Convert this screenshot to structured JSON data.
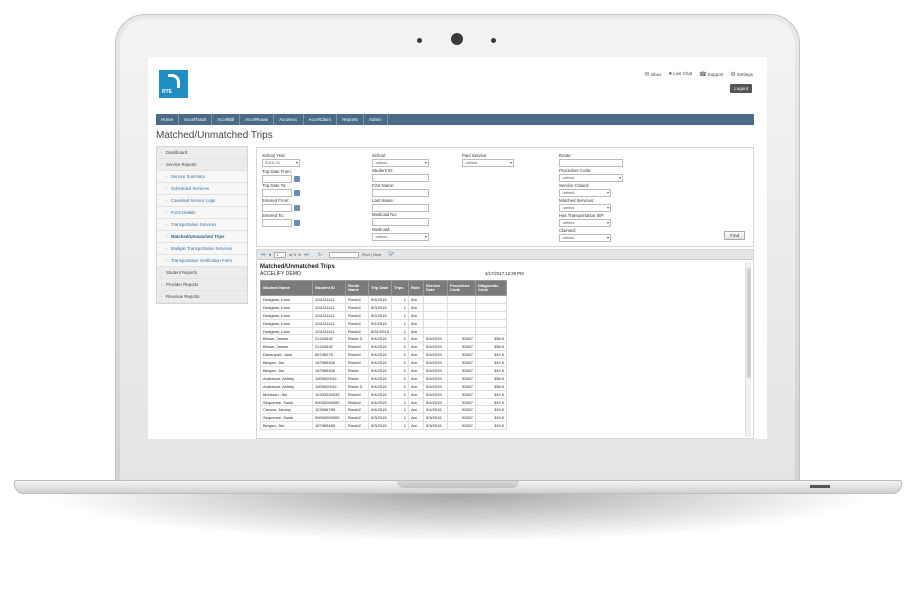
{
  "app": {
    "logo_text": "RTE",
    "topnav": [
      {
        "icon": "mail-icon",
        "glyph": "✉",
        "label": "Inbox"
      },
      {
        "icon": "chat-icon",
        "glyph": "●",
        "label": "Live Chat"
      },
      {
        "icon": "support-icon",
        "glyph": "☎",
        "label": "Support"
      },
      {
        "icon": "gear-icon",
        "glyph": "⚙",
        "label": "Settings"
      }
    ],
    "logout_label": "Logout"
  },
  "menu": [
    "Home",
    "AccelTrack",
    "AccelBill",
    "AccelRoute",
    "AccelAcc",
    "AccelClaim",
    "Reports",
    "Admin"
  ],
  "page_title": "Matched/Unmatched Trips",
  "sidebar": [
    {
      "label": "Dashboard",
      "kind": "hdr"
    },
    {
      "label": "Service Reports",
      "kind": "hdr"
    },
    {
      "label": "Service Summary",
      "kind": "sub"
    },
    {
      "label": "Scheduled Services",
      "kind": "sub"
    },
    {
      "label": "Caseload Service Logs",
      "kind": "sub"
    },
    {
      "label": "Form Details",
      "kind": "sub"
    },
    {
      "label": "Transportation Services",
      "kind": "sub"
    },
    {
      "label": "Matched/Unmatched Trips",
      "kind": "sub active"
    },
    {
      "label": "Multiple Transportation Services",
      "kind": "sub"
    },
    {
      "label": "Transportation Verification Form",
      "kind": "sub"
    },
    {
      "label": "Student Reports",
      "kind": "hdr"
    },
    {
      "label": "Provider Reports",
      "kind": "hdr"
    },
    {
      "label": "Revenue Reports",
      "kind": "hdr"
    }
  ],
  "filters": {
    "school_year": {
      "label": "School Year:",
      "value": "2015-16"
    },
    "trip_date_from": {
      "label": "Trip Date From:"
    },
    "trip_date_to": {
      "label": "Trip Date To:"
    },
    "entered_from": {
      "label": "Entered From:"
    },
    "entered_to": {
      "label": "Entered To:"
    },
    "school": {
      "label": "School:",
      "value": "-select-"
    },
    "student_id": {
      "label": "Student ID:"
    },
    "first_name": {
      "label": "First Name:"
    },
    "last_name": {
      "label": "Last Name:"
    },
    "medicaid_no": {
      "label": "Medicaid No:"
    },
    "medicaid": {
      "label": "Medicaid:",
      "value": "-select-"
    },
    "paid_service": {
      "label": "Paid Service:",
      "value": "-select-"
    },
    "route": {
      "label": "Route:"
    },
    "procedure_code": {
      "label": "Procedure Code:",
      "value": "-select-"
    },
    "service_closed": {
      "label": "Service Closed:",
      "value": "-select-"
    },
    "matched_services": {
      "label": "Matched Services:",
      "value": "-select-"
    },
    "has_transportation_iep": {
      "label": "Has Transportation IEP:",
      "value": "-select-"
    },
    "claimed": {
      "label": "Claimed:",
      "value": "-select-"
    },
    "find_label": "Find"
  },
  "toolbar": {
    "page": "1",
    "of_pages": "of 3",
    "find_next": "Find | Next"
  },
  "report": {
    "title": "Matched/Unmatched Trips",
    "subtitle": "ACCELIFY DEMO",
    "date": "4/17/2017 12:28 PM",
    "columns": [
      "Student Name",
      "Student ID",
      "Route Name",
      "Trip Date",
      "Trips",
      "Ride",
      "Service Date",
      "Procedure Code",
      "Diagnostic Code"
    ],
    "rows": [
      [
        "Hodgens, Liam",
        "1111111111",
        "Route2",
        "9/4/2015",
        "1",
        "Am",
        "",
        "",
        ""
      ],
      [
        "Hodgens, Liam",
        "1111111111",
        "Route2",
        "9/3/2015",
        "1",
        "Am",
        "",
        "",
        ""
      ],
      [
        "Hodgens, Liam",
        "1111111111",
        "Route2",
        "9/2/2015",
        "1",
        "Am",
        "",
        "",
        ""
      ],
      [
        "Hodgens, Liam",
        "1111111111",
        "Route2",
        "9/1/2015",
        "1",
        "Am",
        "",
        "",
        ""
      ],
      [
        "Hodgens, Liam",
        "1111111111",
        "Route2",
        "8/31/2015",
        "1",
        "Am",
        "",
        "",
        ""
      ],
      [
        "Brown, James",
        "21234432",
        "Route 3",
        "9/4/2015",
        "1",
        "Am",
        "9/4/2015",
        "92507",
        "358.9"
      ],
      [
        "Brown, James",
        "21234432",
        "Route2",
        "9/4/2015",
        "1",
        "Am",
        "9/4/2015",
        "92507",
        "358.9"
      ],
      [
        "Davenport, Jack",
        "65746275",
        "Route2",
        "9/4/2015",
        "1",
        "Am",
        "9/4/2015",
        "92507",
        "343.9"
      ],
      [
        "Bergen, Jim",
        "187965465",
        "Route2",
        "9/4/2015",
        "1",
        "Am",
        "9/4/2015",
        "92507",
        "343.9"
      ],
      [
        "Bergen, Jim",
        "187965465",
        "Route",
        "9/4/2015",
        "1",
        "Am",
        "9/4/2015",
        "92507",
        "343.9"
      ],
      [
        "Andreson, Ashley",
        "1000000011",
        "Route",
        "9/4/2015",
        "1",
        "Am",
        "9/4/2015",
        "92507",
        "358.9"
      ],
      [
        "Andreson, Ashley",
        "1000000011",
        "Route 3",
        "9/4/2015",
        "1",
        "Am",
        "9/4/2015",
        "92507",
        "358.9"
      ],
      [
        "Morrison, Jim",
        "12333333333",
        "Route2",
        "9/4/2015",
        "1",
        "Am",
        "9/4/2015",
        "92507",
        "343.9"
      ],
      [
        "Sequence, Susie",
        "00000000000",
        "Route2",
        "9/4/2015",
        "1",
        "Am",
        "9/4/2015",
        "92507",
        "343.9"
      ],
      [
        "Carson, Johnny",
        "123456789",
        "Route2",
        "9/4/2015",
        "1",
        "Am",
        "9/4/2015",
        "92507",
        "343.9"
      ],
      [
        "Sequence, Susie",
        "00000000000",
        "Route2",
        "9/3/2015",
        "1",
        "Am",
        "9/3/2015",
        "92507",
        "343.9"
      ],
      [
        "Bergen, Jim",
        "187965465",
        "Route2",
        "9/3/2015",
        "1",
        "Am",
        "9/3/2015",
        "92507",
        "343.9"
      ]
    ]
  }
}
